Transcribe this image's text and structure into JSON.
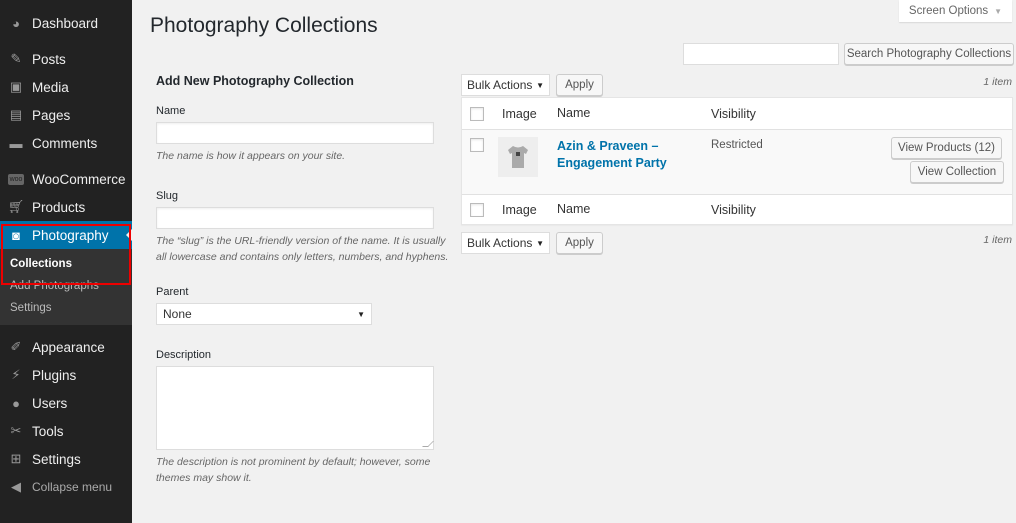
{
  "sidebar": {
    "items": [
      {
        "label": "Dashboard",
        "icon": "dashboard-icon"
      },
      {
        "label": "Posts",
        "icon": "pin-icon"
      },
      {
        "label": "Media",
        "icon": "media-icon"
      },
      {
        "label": "Pages",
        "icon": "pages-icon"
      },
      {
        "label": "Comments",
        "icon": "comment-icon"
      },
      {
        "label": "WooCommerce",
        "icon": "woo-icon"
      },
      {
        "label": "Products",
        "icon": "cart-icon"
      },
      {
        "label": "Photography",
        "icon": "camera-icon"
      },
      {
        "label": "Appearance",
        "icon": "brush-icon"
      },
      {
        "label": "Plugins",
        "icon": "plug-icon"
      },
      {
        "label": "Users",
        "icon": "user-icon"
      },
      {
        "label": "Tools",
        "icon": "wrench-icon"
      },
      {
        "label": "Settings",
        "icon": "sliders-icon"
      }
    ],
    "submenu": [
      "Collections",
      "Add Photographs",
      "Settings"
    ],
    "collapse_label": "Collapse menu"
  },
  "header": {
    "title": "Photography Collections",
    "screen_options": "Screen Options"
  },
  "search": {
    "value": "",
    "button": "Search Photography Collections"
  },
  "form": {
    "heading": "Add New Photography Collection",
    "name_label": "Name",
    "name_value": "",
    "name_desc": "The name is how it appears on your site.",
    "slug_label": "Slug",
    "slug_value": "",
    "slug_desc": "The “slug” is the URL-friendly version of the name. It is usually all lowercase and contains only letters, numbers, and hyphens.",
    "parent_label": "Parent",
    "parent_value": "None",
    "description_label": "Description",
    "description_value": "",
    "description_desc": "The description is not prominent by default; however, some themes may show it."
  },
  "table": {
    "bulk_actions": "Bulk Actions",
    "apply": "Apply",
    "count": "1 item",
    "columns": [
      "Image",
      "Name",
      "Visibility"
    ],
    "rows": [
      {
        "name": "Azin & Praveen – Engagement Party",
        "visibility": "Restricted",
        "view_products": "View Products (12)",
        "view_collection": "View Collection"
      }
    ]
  },
  "colors": {
    "accent": "#0073aa",
    "sidebar_bg": "#222222",
    "highlight": "#ee0000"
  }
}
